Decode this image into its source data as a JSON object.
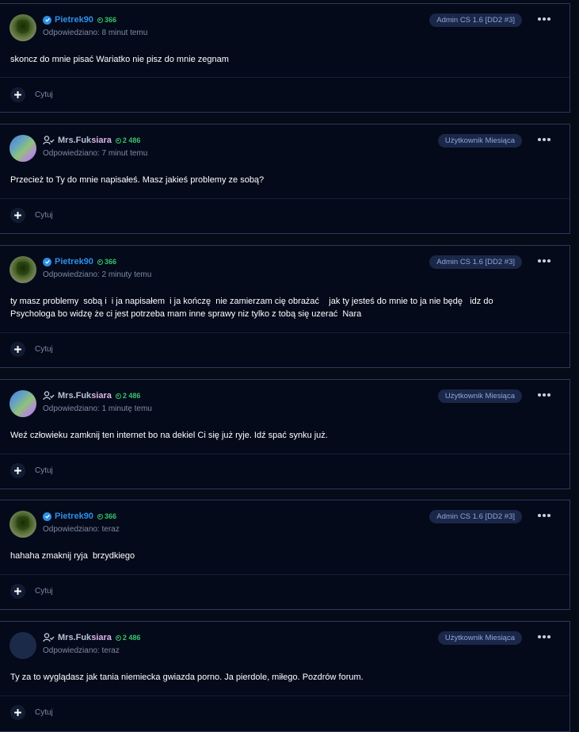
{
  "posts": [
    {
      "author": "Pietrek90",
      "author_parts": [
        "Pietrek90",
        ""
      ],
      "reputation": "366",
      "timestamp": "Odpowiedziano: 8 minut temu",
      "badge": "Admin CS 1.6 [DD2 #3]",
      "content": [
        "skoncz do mnie pisać Wariatko  nie pisz do mnie zegnam"
      ],
      "quote_label": "Cytuj"
    },
    {
      "author": "Mrs.Fuksiara",
      "author_parts": [
        "Mrs.Fuk",
        "siara"
      ],
      "reputation": "2 486",
      "timestamp": "Odpowiedziano: 7 minut temu",
      "badge": "Użytkownik Miesiąca",
      "content": [
        "Przecież to Ty do mnie napisałeś. Masz jakieś problemy ze sobą?"
      ],
      "quote_label": "Cytuj"
    },
    {
      "author": "Pietrek90",
      "author_parts": [
        "Pietrek90",
        ""
      ],
      "reputation": "366",
      "timestamp": "Odpowiedziano: 2 minuty temu",
      "badge": "Admin CS 1.6 [DD2 #3]",
      "content": [
        "ty masz problemy  sobą i  i ja napisałem  i ja kończę  nie zamierzam cię obrażać    jak ty jesteś do mnie to ja nie będę   idz do",
        "Psychologa bo widzę że ci jest potrzeba mam inne sprawy niz tylko z tobą się uzerać  Nara"
      ],
      "quote_label": "Cytuj"
    },
    {
      "author": "Mrs.Fuksiara",
      "author_parts": [
        "Mrs.Fuk",
        "siara"
      ],
      "reputation": "2 486",
      "timestamp": "Odpowiedziano: 1 minutę temu",
      "badge": "Użytkownik Miesiąca",
      "content": [
        "Weź człowieku zamknij ten internet bo na dekiel Ci się już ryje. Idź spać synku już."
      ],
      "quote_label": "Cytuj"
    },
    {
      "author": "Pietrek90",
      "author_parts": [
        "Pietrek90",
        ""
      ],
      "reputation": "366",
      "timestamp": "Odpowiedziano: teraz",
      "badge": "Admin CS 1.6 [DD2 #3]",
      "content": [
        "hahaha zmaknij ryja  brzydkiego"
      ],
      "quote_label": "Cytuj"
    },
    {
      "author": "Mrs.Fuksiara",
      "author_parts": [
        "Mrs.Fuk",
        "siara"
      ],
      "reputation": "2 486",
      "timestamp": "Odpowiedziano: teraz",
      "badge": "Użytkownik Miesiąca",
      "content": [
        "Ty za to wyglądasz jak tania niemiecka gwiazda porno. Ja pierdole, miłego. Pozdrów forum."
      ],
      "quote_label": "Cytuj"
    }
  ],
  "colors": {
    "background": "#060b18",
    "card": "#040a1a",
    "admin_name": "#2d8fe6",
    "reputation": "#37c46a",
    "badge_bg": "#1a2748",
    "badge_text": "#8fa6d9"
  },
  "icons": {
    "verified": "verified-check-icon",
    "user": "user-icon",
    "reputation": "reputation-icon",
    "more": "more-options-icon",
    "plus": "plus-icon"
  }
}
